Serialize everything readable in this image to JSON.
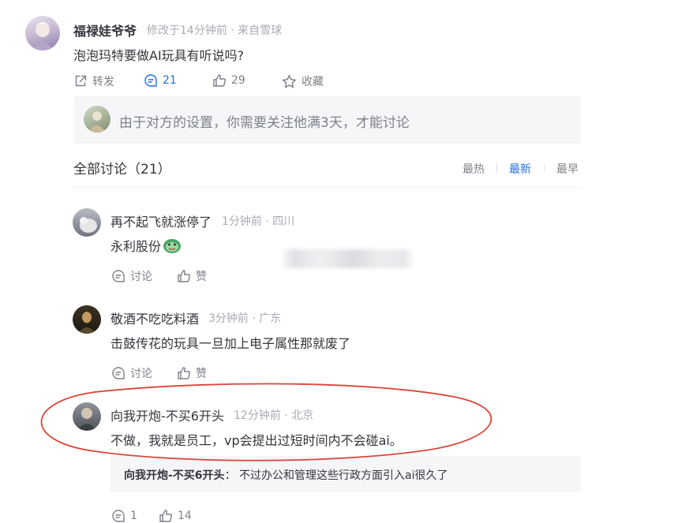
{
  "post": {
    "author": "福禄娃爷爷",
    "meta": "修改于14分钟前 · 来自雪球",
    "content": "泡泡玛特要做AI玩具有听说吗?",
    "actions": {
      "repost": "转发",
      "comments": "21",
      "likes": "29",
      "favorite": "收藏"
    },
    "notice": "由于对方的设置，你需要关注他满3天，才能讨论"
  },
  "discussion": {
    "title": "全部讨论（21）",
    "sort": [
      "最热",
      "最新",
      "最早"
    ],
    "active_sort": "最新"
  },
  "comments": [
    {
      "author": "再不起飞就涨停了",
      "meta": "1分钟前 · 四川",
      "content": "永利股份",
      "discuss": "讨论",
      "like": "赞"
    },
    {
      "author": "敬酒不吃吃料酒",
      "meta": "3分钟前 · 广东",
      "content": "击鼓传花的玩具一旦加上电子属性那就废了",
      "discuss": "讨论",
      "like": "赞"
    },
    {
      "author": "向我开炮-不买6开头",
      "meta": "12分钟前 · 北京",
      "content": "不做，我就是员工，vp会提出过短时间内不会碰ai。",
      "quote_author": "向我开炮-不买6开头",
      "quote_sep": "：",
      "quote_text": "不过办公和管理这些行政方面引入ai很久了",
      "footer_comments": "1",
      "footer_likes": "14"
    }
  ],
  "colors": {
    "accent": "#1f6fde",
    "highlight_ellipse": "#d9463a",
    "text": "#33353c",
    "muted": "#a8abb3"
  }
}
